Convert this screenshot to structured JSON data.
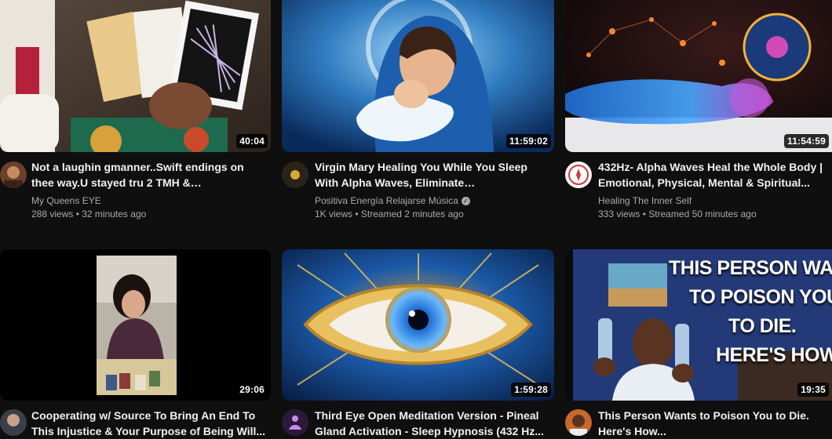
{
  "videos": [
    {
      "title": "Not a laughin gmanner..Swift endings on thee way.U stayed tru 2 TMH & urself..These...",
      "channel": "My Queens EYE",
      "meta": "288 views • 32 minutes ago",
      "duration": "40:04",
      "thumb_icon": "tarot-cards-thumbnail",
      "verified": false
    },
    {
      "title": "Virgin Mary Healing You While You Sleep With Alpha Waves, Eliminate Subconscious...",
      "channel": "Positiva Energía Relajarse Música",
      "meta": "1K views • Streamed 2 minutes ago",
      "duration": "11:59:02",
      "thumb_icon": "virgin-mary-thumbnail",
      "verified": true
    },
    {
      "title": "432Hz- Alpha Waves Heal the Whole Body | Emotional, Physical, Mental & Spiritual...",
      "channel": "Healing The Inner Self",
      "meta": "333 views • Streamed 50 minutes ago",
      "duration": "11:54:59",
      "thumb_icon": "glowing-body-thumbnail",
      "verified": false
    },
    {
      "title": "Cooperating w/ Source To Bring An End To This Injustice & Your Purpose of Being Will...",
      "channel": "",
      "meta": "",
      "duration": "29:06",
      "thumb_icon": "tarot-reader-thumbnail",
      "verified": false
    },
    {
      "title": "Third Eye Open Meditation Version - Pineal Gland Activation - Sleep Hypnosis (432 Hz...",
      "channel": "",
      "meta": "",
      "duration": "1:59:28",
      "thumb_icon": "third-eye-thumbnail",
      "verified": false
    },
    {
      "title": "This Person Wants to Poison You to Die. Here's How...",
      "channel": "",
      "meta": "",
      "duration": "19:35",
      "thumb_icon": "man-water-bottles-thumbnail",
      "verified": false
    }
  ],
  "thumb6_text": {
    "line1": "THIS PERSON WANTS",
    "line2": "TO POISON YOU",
    "line3": "TO DIE.",
    "line4": "HERE'S HOW..."
  },
  "colors": {
    "background": "#0f0f0f",
    "title": "#f1f1f1",
    "secondary": "#aaaaaa"
  }
}
